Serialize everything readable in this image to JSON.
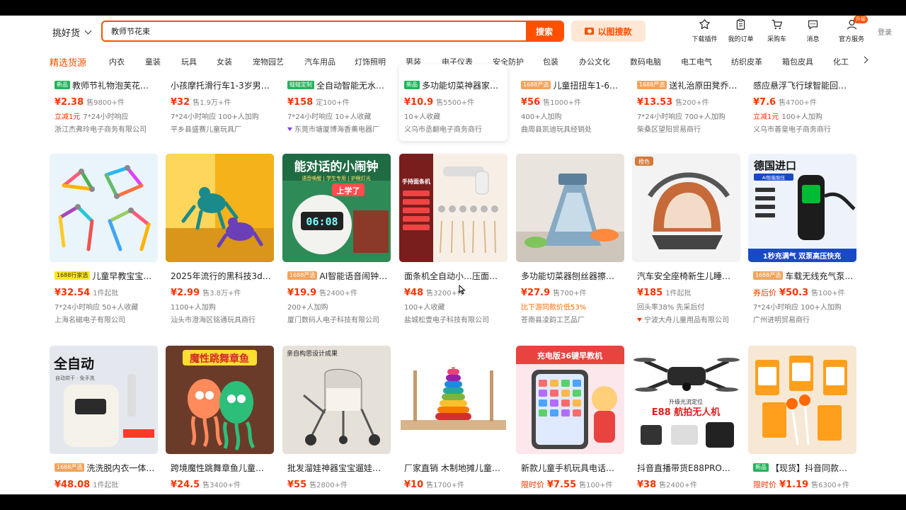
{
  "header": {
    "scope_label": "挑好货",
    "search_value": "教师节花束",
    "search_button": "搜索",
    "image_search": "以图搜款",
    "tools": [
      {
        "label": "下载插件",
        "icon": "plugin-icon"
      },
      {
        "label": "我的订单",
        "icon": "orders-icon"
      },
      {
        "label": "采购车",
        "icon": "cart-icon"
      },
      {
        "label": "消息",
        "icon": "message-icon"
      },
      {
        "label": "官方服务",
        "icon": "service-icon",
        "badge": "升级"
      }
    ],
    "login": "登录",
    "accent_color": "#ff5000"
  },
  "categories": {
    "featured": "精选货源",
    "items": [
      "内衣",
      "童装",
      "玩具",
      "女装",
      "宠物园艺",
      "汽车用品",
      "灯饰照明",
      "男装",
      "电子仪表",
      "安全防护",
      "包装",
      "办公文化",
      "数码电脑",
      "电工电气",
      "纺织皮革",
      "箱包皮具",
      "化工"
    ]
  },
  "rows": [
    [
      {
        "tag": "新品",
        "title": "教师节礼物泡芙花…",
        "prefix": "",
        "price": "¥2.38",
        "sold": "售9800+件",
        "extra_red": "立减1元",
        "extra": "7*24小时响应",
        "shop": "浙江杰弗玲电子商务有限公司"
      },
      {
        "tag": "",
        "title": "小孩摩托滑行车1-3岁男…",
        "prefix": "",
        "price": "¥32",
        "sold": "售1.9万+件",
        "extra_red": "",
        "extra": "7*24小时响应  100+人加购",
        "shop": "平乡县盛赛儿童玩具厂"
      },
      {
        "tag": "蛙蛙定制",
        "title": "全自动智能无水…",
        "prefix": "",
        "price": "¥158",
        "sold": "定100+件",
        "extra_red": "",
        "extra": "7*24小时响应  10+人收藏",
        "shop": "东莞市塘厦博海香薰电器厂"
      },
      {
        "tag": "新品",
        "title": "多功能切菜神器家…",
        "prefix": "",
        "price": "¥10.9",
        "sold": "售5500+件",
        "extra_red": "",
        "extra": "10+人收藏",
        "shop": "义乌市丞翻电子商务商行"
      },
      {
        "tag": "1688严选",
        "title": "儿童扭扭车1-6…",
        "prefix": "",
        "price": "¥56",
        "sold": "售1000+件",
        "extra_red": "",
        "extra": "400+人加购",
        "shop": "曲周县凯迪玩具经销处"
      },
      {
        "tag": "1688严选",
        "title": "送礼治原田凳乔…",
        "prefix": "",
        "price": "¥13.53",
        "sold": "售200+件",
        "extra_red": "",
        "extra": "7*24小时响应  700+人加购",
        "shop": "柴桑区望阳贸易商行"
      },
      {
        "tag": "",
        "title": "感应悬浮飞行球智能回…",
        "prefix": "",
        "price": "¥7.6",
        "sold": "售4700+件",
        "extra_red": "立减1元",
        "extra": "100+人加购",
        "shop": "义乌市善皇电子商务商行"
      }
    ],
    [
      {
        "tag": "1688行家选",
        "title": "儿童早教宝宝…",
        "prefix": "",
        "price": "¥32.54",
        "sold": "1件起批",
        "extra_red": "",
        "extra": "7*24小时响应  50+人收藏",
        "shop": "上海名磁电子有限公司"
      },
      {
        "tag": "",
        "title": "2025年流行的黑科技3d…",
        "prefix": "",
        "price": "¥2.99",
        "sold": "售3.8万+件",
        "extra_red": "",
        "extra": "1100+人加购",
        "shop": "汕头市澄海区铭通玩具商行"
      },
      {
        "tag": "1688严选",
        "title": "AI智能语音闹钟…",
        "prefix": "",
        "price": "¥19.9",
        "sold": "售2400+件",
        "extra_red": "",
        "extra": "200+人加购",
        "shop": "厦门数码人电子科技有限公司"
      },
      {
        "tag": "",
        "title": "面条机全自动小…压面…",
        "prefix": "",
        "price": "¥48",
        "sold": "售3200+件",
        "extra_red": "",
        "extra": "100+人收藏",
        "shop": "盐城松壹电子科技有限公司"
      },
      {
        "tag": "",
        "title": "多功能切菜器刨丝器擦…",
        "prefix": "",
        "price": "¥27.9",
        "sold": "售700+件",
        "extra_red": "",
        "extra_orange": "比下游同款价低53%",
        "extra": "",
        "shop": "苍南县凌韵工艺品厂"
      },
      {
        "tag": "",
        "title": "汽车安全座椅新生儿睡…",
        "prefix": "",
        "price": "¥185",
        "sold": "1件起批",
        "extra_red": "",
        "extra": "回头率38%  先采后付",
        "shop": "宁波大舟儿童用品有限公司"
      },
      {
        "tag": "1688严选",
        "title": "车载无线充气泵…",
        "prefix": "券后价",
        "price": "¥50.3",
        "sold": "售100+件",
        "extra_red": "",
        "extra": "7*24小时响应  100+人加购",
        "shop": "广州进明贸易商行"
      }
    ],
    [
      {
        "tag": "1688严选",
        "title": "洗洗脱内衣一体…",
        "prefix": "",
        "price": "¥48.08",
        "sold": "1件起批"
      },
      {
        "tag": "",
        "title": "跨境魔性跳舞章鱼儿童…",
        "prefix": "",
        "price": "¥24.5",
        "sold": "售3400+件"
      },
      {
        "tag": "",
        "title": "批发溜娃神器宝宝遛娃…",
        "prefix": "",
        "price": "¥55",
        "sold": "售2800+件"
      },
      {
        "tag": "",
        "title": "厂家直销 木制地摊儿童…",
        "prefix": "",
        "price": "¥10",
        "sold": "售1700+件"
      },
      {
        "tag": "",
        "title": "新款儿童手机玩具电话…",
        "prefix": "限时价",
        "price": "¥7.55",
        "sold": "售100+件"
      },
      {
        "tag": "",
        "title": "抖音直播带货E88PRO折…",
        "prefix": "",
        "price": "¥38",
        "sold": "售2400+件"
      },
      {
        "tag": "新品",
        "title": "【现货】抖音同款…",
        "prefix": "限时价",
        "price": "¥1.19",
        "sold": "售6300+件"
      }
    ]
  ],
  "image_text": {
    "clock_title": "能对话的小闹钟",
    "clock_sub": "语音唤醒 | 学生专用 | 护眼灯光",
    "clock_bubble": "上学了",
    "clock_time": "06:08",
    "noodle_title": "手持面条机",
    "seat_tag": "橙色",
    "pump_head": "德国进口",
    "pump_sub": "AI智能胎压",
    "pump_bottom": "1秒充满气 双泵高压快充",
    "washer_tag": "全自动",
    "washer_sub": "自动烘干 · 免手洗",
    "octopus_title": "魔性跳舞章鱼",
    "stroller_title": "亲自构思设计成果",
    "phone_title": "充电版36键早教机",
    "drone_sub": "升级光流定位",
    "drone_title": "E88 航拍无人机"
  }
}
